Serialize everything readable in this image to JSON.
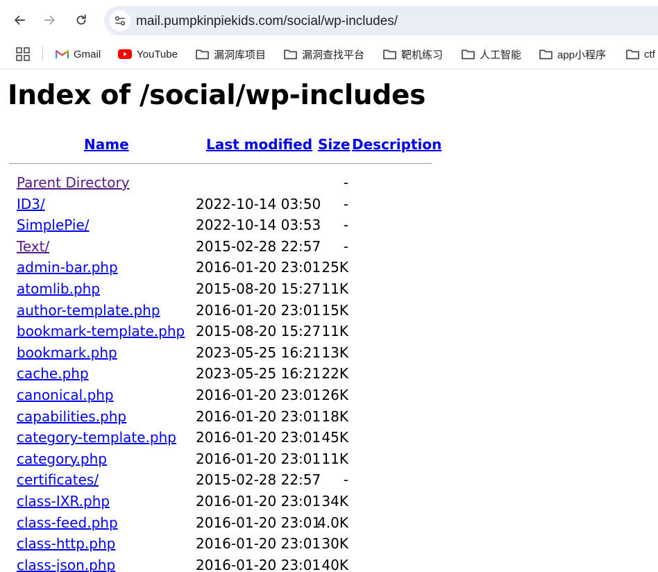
{
  "browser": {
    "url": "mail.pumpkinpiekids.com/social/wp-includes/",
    "bookmarks": [
      {
        "label": "Gmail",
        "icon": "gmail-icon"
      },
      {
        "label": "YouTube",
        "icon": "youtube-icon"
      },
      {
        "label": "漏洞库项目",
        "icon": "folder-icon"
      },
      {
        "label": "漏洞查找平台",
        "icon": "folder-icon"
      },
      {
        "label": "靶机练习",
        "icon": "folder-icon"
      },
      {
        "label": "人工智能",
        "icon": "folder-icon"
      },
      {
        "label": "app小程序",
        "icon": "folder-icon"
      },
      {
        "label": "ctf",
        "icon": "folder-icon"
      }
    ]
  },
  "page": {
    "title": "Index of /social/wp-includes",
    "headers": {
      "name": "Name",
      "last_modified": "Last modified",
      "size": "Size",
      "description": "Description"
    },
    "rows": [
      {
        "name": "Parent Directory",
        "date": "",
        "size": "-",
        "visited": true
      },
      {
        "name": "ID3/",
        "date": "2022-10-14 03:50",
        "size": "-"
      },
      {
        "name": "SimplePie/",
        "date": "2022-10-14 03:53",
        "size": "-"
      },
      {
        "name": "Text/",
        "date": "2015-02-28 22:57",
        "size": "-",
        "visited": true
      },
      {
        "name": "admin-bar.php",
        "date": "2016-01-20 23:01",
        "size": "25K"
      },
      {
        "name": "atomlib.php",
        "date": "2015-08-20 15:27",
        "size": "11K"
      },
      {
        "name": "author-template.php",
        "date": "2016-01-20 23:01",
        "size": "15K"
      },
      {
        "name": "bookmark-template.php",
        "date": "2015-08-20 15:27",
        "size": "11K"
      },
      {
        "name": "bookmark.php",
        "date": "2023-05-25 16:21",
        "size": "13K"
      },
      {
        "name": "cache.php",
        "date": "2023-05-25 16:21",
        "size": "22K"
      },
      {
        "name": "canonical.php",
        "date": "2016-01-20 23:01",
        "size": "26K"
      },
      {
        "name": "capabilities.php",
        "date": "2016-01-20 23:01",
        "size": "18K"
      },
      {
        "name": "category-template.php",
        "date": "2016-01-20 23:01",
        "size": "45K"
      },
      {
        "name": "category.php",
        "date": "2016-01-20 23:01",
        "size": "11K"
      },
      {
        "name": "certificates/",
        "date": "2015-02-28 22:57",
        "size": "-"
      },
      {
        "name": "class-IXR.php",
        "date": "2016-01-20 23:01",
        "size": "34K"
      },
      {
        "name": "class-feed.php",
        "date": "2016-01-20 23:01",
        "size": "4.0K"
      },
      {
        "name": "class-http.php",
        "date": "2016-01-20 23:01",
        "size": "30K"
      },
      {
        "name": "class-json.php",
        "date": "2016-01-20 23:01",
        "size": "40K"
      }
    ]
  }
}
